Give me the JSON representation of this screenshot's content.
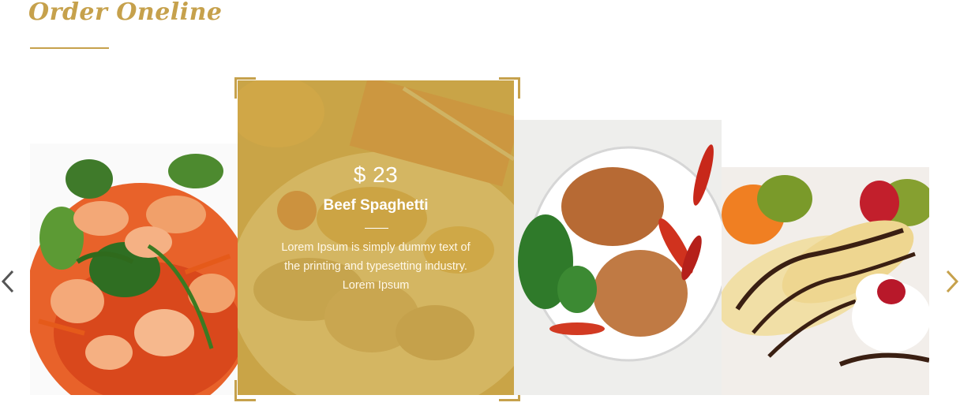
{
  "section": {
    "title": "Order Oneline"
  },
  "theme": {
    "accent_color": "#c6a14c",
    "overlay_color": "#cdaa46"
  },
  "navigation": {
    "prev_icon": "chevron-left-icon",
    "next_icon": "chevron-right-icon"
  },
  "featured_item": {
    "price": "$ 23",
    "name": "Beef Spaghetti",
    "description": "Lorem Ipsum is simply dummy text of the printing and typesetting industry. Lorem Ipsum"
  }
}
